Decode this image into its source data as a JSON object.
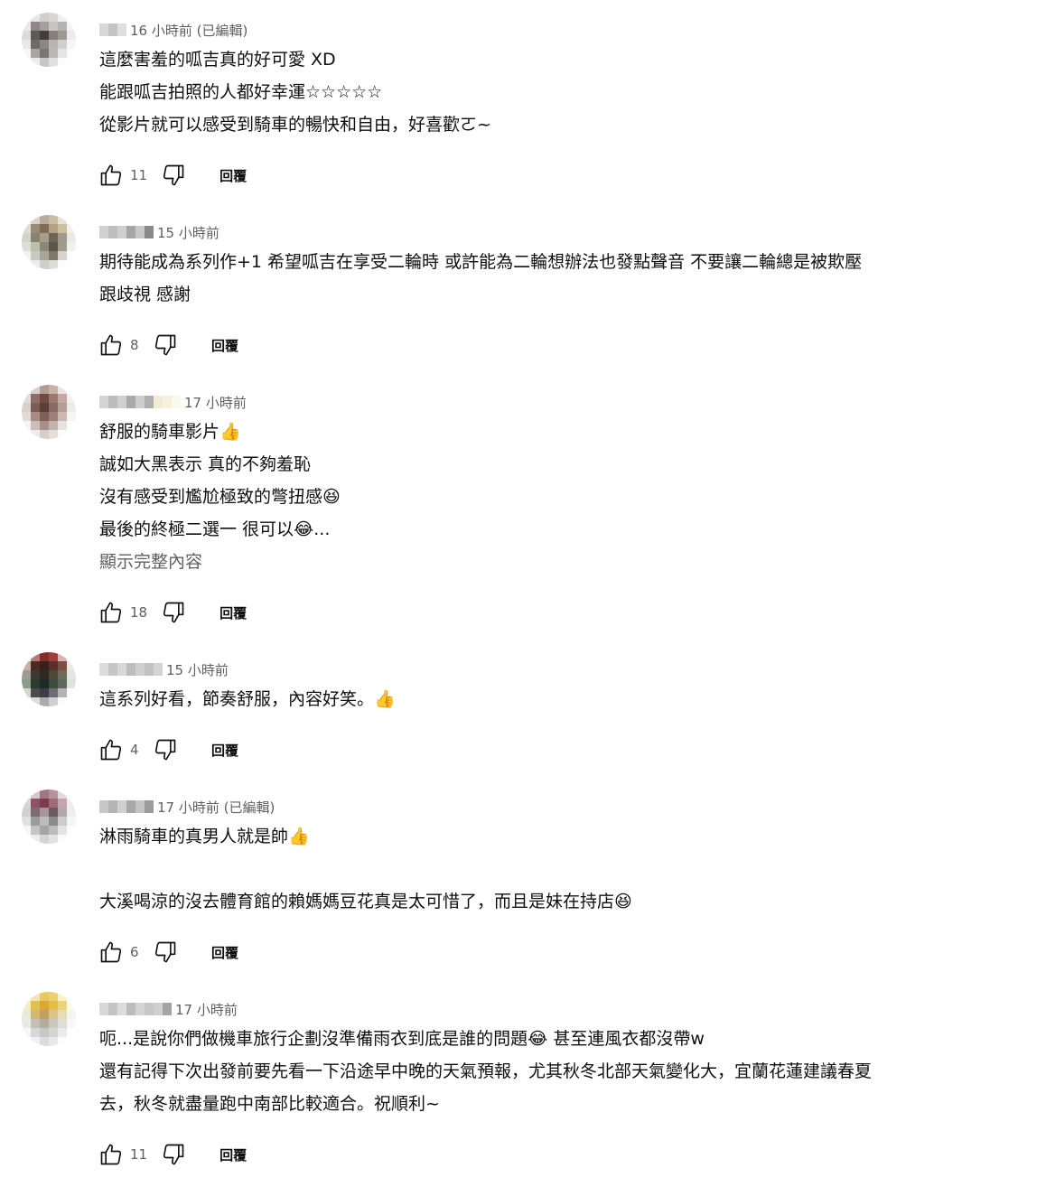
{
  "reply_label": "回覆",
  "comments": [
    {
      "time": "16 小時前 (已編輯)",
      "lines": [
        "這麼害羞的呱吉真的好可愛 XD",
        "能跟呱吉拍照的人都好幸運☆☆☆☆☆",
        "從影片就可以感受到騎車的暢快和自由，好喜歡ㄛ~"
      ],
      "likes": "11"
    },
    {
      "time": "15 小時前",
      "lines": [
        "期待能成為系列作+1  希望呱吉在享受二輪時  或許能為二輪想辦法也發點聲音  不要讓二輪總是被欺壓",
        "跟歧視 感謝"
      ],
      "likes": "8"
    },
    {
      "time": "17 小時前",
      "lines": [
        "舒服的騎車影片👍",
        "誠如大黑表示 真的不夠羞恥",
        "沒有感受到尷尬極致的彆扭感😆",
        "最後的終極二選一 很可以😂..."
      ],
      "more": "顯示完整內容",
      "likes": "18"
    },
    {
      "time": "15 小時前",
      "lines": [
        "這系列好看，節奏舒服，內容好笑。👍"
      ],
      "likes": "4"
    },
    {
      "time": "17 小時前 (已編輯)",
      "lines": [
        "淋雨騎車的真男人就是帥👍",
        "",
        "大溪喝涼的沒去體育館的賴媽媽豆花真是太可惜了，而且是妹在持店😆"
      ],
      "likes": "6"
    },
    {
      "time": "17 小時前",
      "lines": [
        "呃...是說你們做機車旅行企劃沒準備雨衣到底是誰的問題😂  甚至連風衣都沒帶w",
        "還有記得下次出發前要先看一下沿途早中晚的天氣預報，尤其秋冬北部天氣變化大，宜蘭花蓮建議春夏",
        "去，秋冬就盡量跑中南部比較適合。祝順利~"
      ],
      "likes": "11"
    }
  ]
}
